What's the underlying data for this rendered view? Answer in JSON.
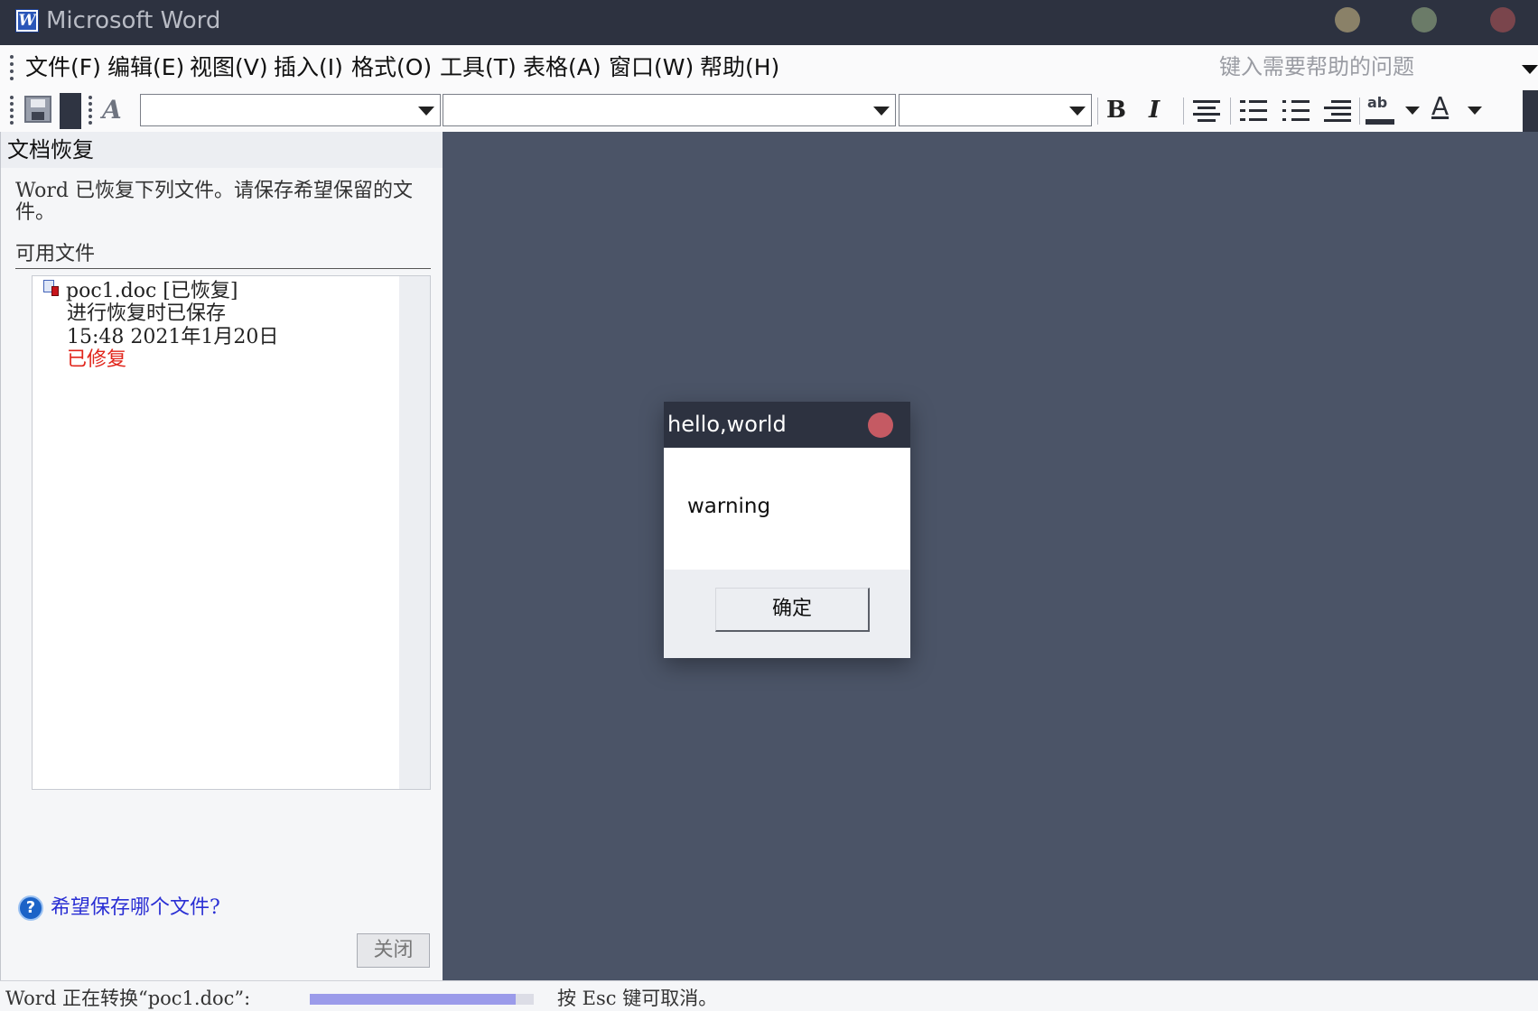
{
  "window": {
    "title": "Microsoft Word",
    "app_icon_letter": "W",
    "controls": {
      "minimize_color": "#8a8168",
      "maximize_color": "#6b7b68",
      "close_color": "#7a454c"
    }
  },
  "menu": {
    "items": [
      "文件(F)",
      "编辑(E)",
      "视图(V)",
      "插入(I)",
      "格式(O)",
      "工具(T)",
      "表格(A)",
      "窗口(W)",
      "帮助(H)"
    ],
    "help_placeholder": "键入需要帮助的问题"
  },
  "toolbar": {
    "styles_icon_text": "A",
    "style_value": "",
    "font_value": "",
    "size_value": "",
    "bold_label": "B",
    "italic_label": "I",
    "highlight_label": "ab",
    "font_color_label": "A",
    "icons": [
      "save-icon",
      "document-icon",
      "styles-icon",
      "bold-icon",
      "italic-icon",
      "align-icon",
      "numbered-list-icon",
      "bullet-list-icon",
      "indent-icon",
      "highlight-icon",
      "font-color-icon"
    ]
  },
  "task_pane": {
    "title": "文档恢复",
    "message": "Word 已恢复下列文件。请保存希望保留的文件。",
    "available_label": "可用文件",
    "files": [
      {
        "name": "poc1.doc  [已恢复]",
        "status": "进行恢复时已保存",
        "time": "15:48 2021年1月20日",
        "repair_status": "已修复"
      }
    ],
    "help_link": "希望保存哪个文件?",
    "help_icon_glyph": "?",
    "close_button": "关闭"
  },
  "dialog": {
    "title": "hello,world",
    "message": "warning",
    "ok_button": "确定",
    "close_color": "#c55a63"
  },
  "status_bar": {
    "text": "Word 正在转换“poc1.doc”:",
    "progress_fraction": 0.92,
    "hint": "按 Esc 键可取消。"
  }
}
